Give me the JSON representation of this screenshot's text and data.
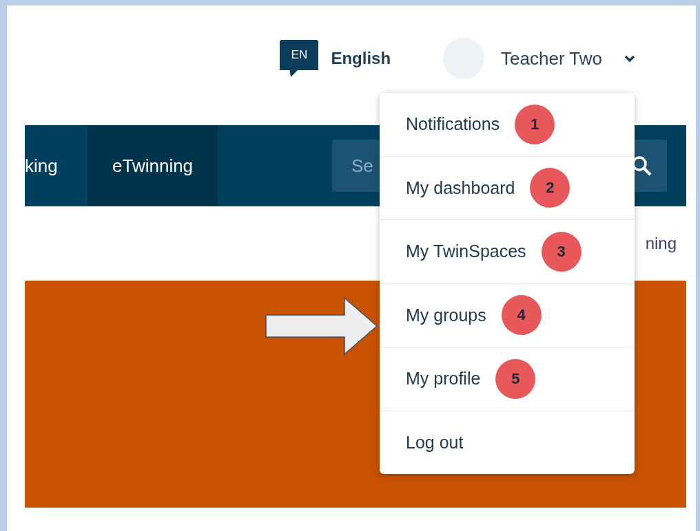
{
  "header": {
    "language_badge": "EN",
    "language": "English",
    "user_name": "Teacher Two"
  },
  "nav": {
    "items": [
      {
        "label": "king",
        "selected": false
      },
      {
        "label": "eTwinning",
        "selected": true
      }
    ],
    "search": {
      "placeholder": "Se"
    }
  },
  "link": "ning",
  "user_menu": [
    {
      "label": "Notifications",
      "badge": "1"
    },
    {
      "label": "My dashboard",
      "badge": "2"
    },
    {
      "label": "My TwinSpaces",
      "badge": "3"
    },
    {
      "label": "My groups",
      "badge": "4"
    },
    {
      "label": "My profile",
      "badge": "5"
    },
    {
      "label": "Log out"
    }
  ]
}
